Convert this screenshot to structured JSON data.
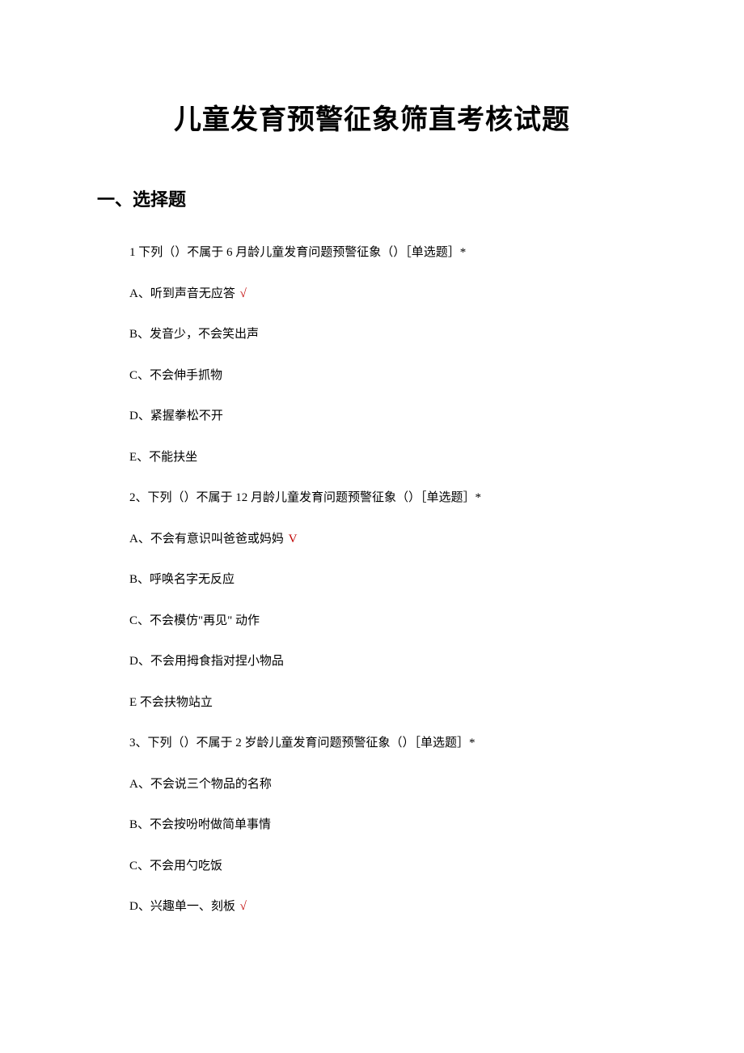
{
  "title": "儿童发育预警征象筛直考核试题",
  "section": "一、选择题",
  "questions": [
    {
      "stem": "1 下列（）不属于 6 月龄儿童发育问题预警征象（）［单选题］*",
      "options": [
        {
          "label": "A、听到声音无应答",
          "mark": "√"
        },
        {
          "label": "B、发音少，不会笑出声",
          "mark": ""
        },
        {
          "label": "C、不会伸手抓物",
          "mark": ""
        },
        {
          "label": "D、紧握拳松不开",
          "mark": ""
        },
        {
          "label": "E、不能扶坐",
          "mark": ""
        }
      ]
    },
    {
      "stem": "2、下列（）不属于 12 月龄儿童发育问题预警征象（）［单选题］*",
      "options": [
        {
          "label": "A、不会有意识叫爸爸或妈妈",
          "mark": "V"
        },
        {
          "label": "B、呼唤名字无反应",
          "mark": ""
        },
        {
          "label": "C、不会模仿\"再见\" 动作",
          "mark": ""
        },
        {
          "label": "D、不会用拇食指对捏小物品",
          "mark": ""
        },
        {
          "label": "E 不会扶物站立",
          "mark": ""
        }
      ]
    },
    {
      "stem": "3、下列（）不属于 2 岁龄儿童发育问题预警征象（）［单选题］*",
      "options": [
        {
          "label": "A、不会说三个物品的名称",
          "mark": ""
        },
        {
          "label": "B、不会按吩咐做简单事情",
          "mark": ""
        },
        {
          "label": "C、不会用勺吃饭",
          "mark": ""
        },
        {
          "label": "D、兴趣单一、刻板",
          "mark": "√"
        }
      ]
    }
  ]
}
